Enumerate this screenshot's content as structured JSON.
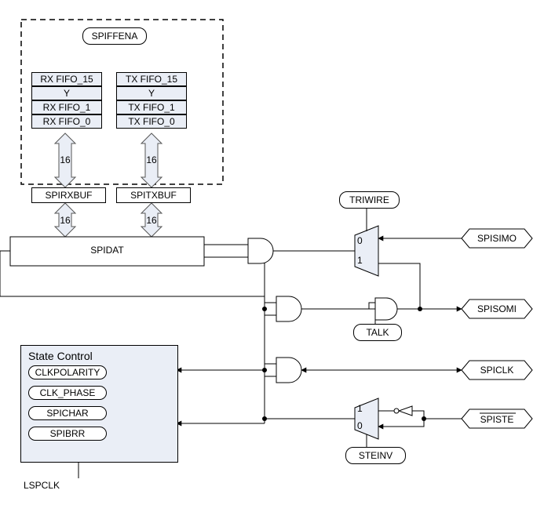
{
  "labels": {
    "spiffena": "SPIFFENA",
    "rx15": "RX FIFO_15",
    "rxY": "Y",
    "rx1": "RX FIFO_1",
    "rx0": "RX FIFO_0",
    "tx15": "TX FIFO_15",
    "txY": "Y",
    "tx1": "TX FIFO_1",
    "tx0": "TX FIFO_0",
    "spirxbuf": "SPIRXBUF",
    "spitxbuf": "SPITXBUF",
    "spidat": "SPIDAT",
    "w16a": "16",
    "w16b": "16",
    "w16c": "16",
    "w16d": "16",
    "statecontrol": "State Control",
    "clkpolarity": "CLKPOLARITY",
    "clkphase": "CLK_PHASE",
    "spichar": "SPICHAR",
    "spibrr": "SPIBRR",
    "lspclk": "LSPCLK",
    "triwire": "TRIWIRE",
    "talk": "TALK",
    "steinv": "STEINV",
    "spisimo": "SPISIMO",
    "spisomi": "SPISOMI",
    "spiclk": "SPICLK",
    "spiste": "SPISTE",
    "mux01a0": "0",
    "mux01a1": "1",
    "mux01b0": "0",
    "mux01b1": "1"
  }
}
